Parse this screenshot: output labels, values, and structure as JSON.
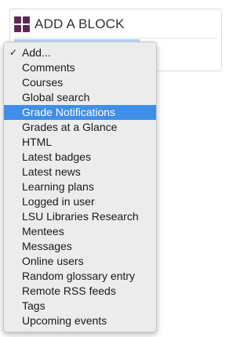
{
  "block": {
    "title": "ADD A BLOCK",
    "icon": "grid-icon",
    "icon_color": "#5e2750"
  },
  "dropdown": {
    "checked_mark": "✓",
    "highlight_color": "#3f8ee8",
    "options": [
      {
        "label": "Add...",
        "checked": true,
        "highlighted": false
      },
      {
        "label": "Comments",
        "checked": false,
        "highlighted": false
      },
      {
        "label": "Courses",
        "checked": false,
        "highlighted": false
      },
      {
        "label": "Global search",
        "checked": false,
        "highlighted": false
      },
      {
        "label": "Grade Notifications",
        "checked": false,
        "highlighted": true
      },
      {
        "label": "Grades at a Glance",
        "checked": false,
        "highlighted": false
      },
      {
        "label": "HTML",
        "checked": false,
        "highlighted": false
      },
      {
        "label": "Latest badges",
        "checked": false,
        "highlighted": false
      },
      {
        "label": "Latest news",
        "checked": false,
        "highlighted": false
      },
      {
        "label": "Learning plans",
        "checked": false,
        "highlighted": false
      },
      {
        "label": "Logged in user",
        "checked": false,
        "highlighted": false
      },
      {
        "label": "LSU Libraries Research",
        "checked": false,
        "highlighted": false
      },
      {
        "label": "Mentees",
        "checked": false,
        "highlighted": false
      },
      {
        "label": "Messages",
        "checked": false,
        "highlighted": false
      },
      {
        "label": "Online users",
        "checked": false,
        "highlighted": false
      },
      {
        "label": "Random glossary entry",
        "checked": false,
        "highlighted": false
      },
      {
        "label": "Remote RSS feeds",
        "checked": false,
        "highlighted": false
      },
      {
        "label": "Tags",
        "checked": false,
        "highlighted": false
      },
      {
        "label": "Upcoming events",
        "checked": false,
        "highlighted": false
      }
    ]
  }
}
